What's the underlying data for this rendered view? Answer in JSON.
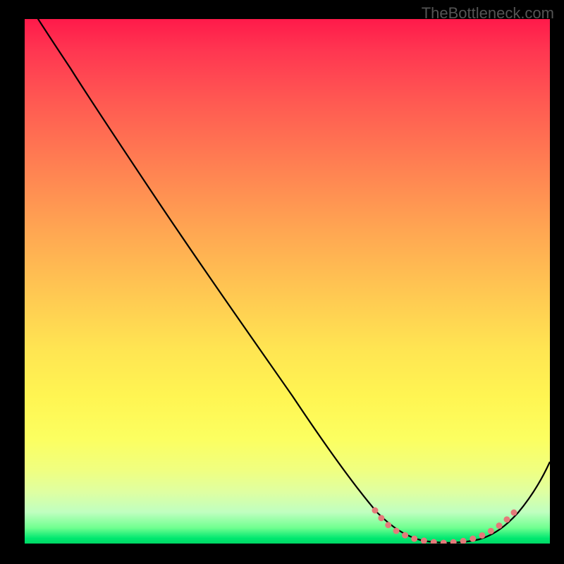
{
  "watermark": "TheBottleneck.com",
  "chart_data": {
    "type": "line",
    "title": "",
    "xlabel": "",
    "ylabel": "",
    "xlim": [
      0,
      100
    ],
    "ylim": [
      0,
      100
    ],
    "grid": false,
    "series": [
      {
        "name": "curve",
        "x": [
          0,
          4,
          8,
          12,
          20,
          30,
          40,
          50,
          60,
          66,
          70,
          74,
          78,
          82,
          86,
          90,
          94,
          100
        ],
        "y": [
          104,
          100,
          95,
          89,
          78,
          64,
          50,
          36,
          22,
          12,
          6,
          2,
          0.5,
          0,
          0.5,
          2,
          6,
          18
        ]
      },
      {
        "name": "highlight-dots",
        "x": [
          66,
          68,
          70,
          72,
          74,
          76,
          78,
          80,
          82,
          84,
          86,
          88,
          90,
          91.5,
          93
        ],
        "y": [
          12,
          9,
          6,
          4,
          2,
          1,
          0.5,
          0.2,
          0,
          0.2,
          0.5,
          1,
          2,
          3.5,
          5
        ]
      }
    ]
  }
}
